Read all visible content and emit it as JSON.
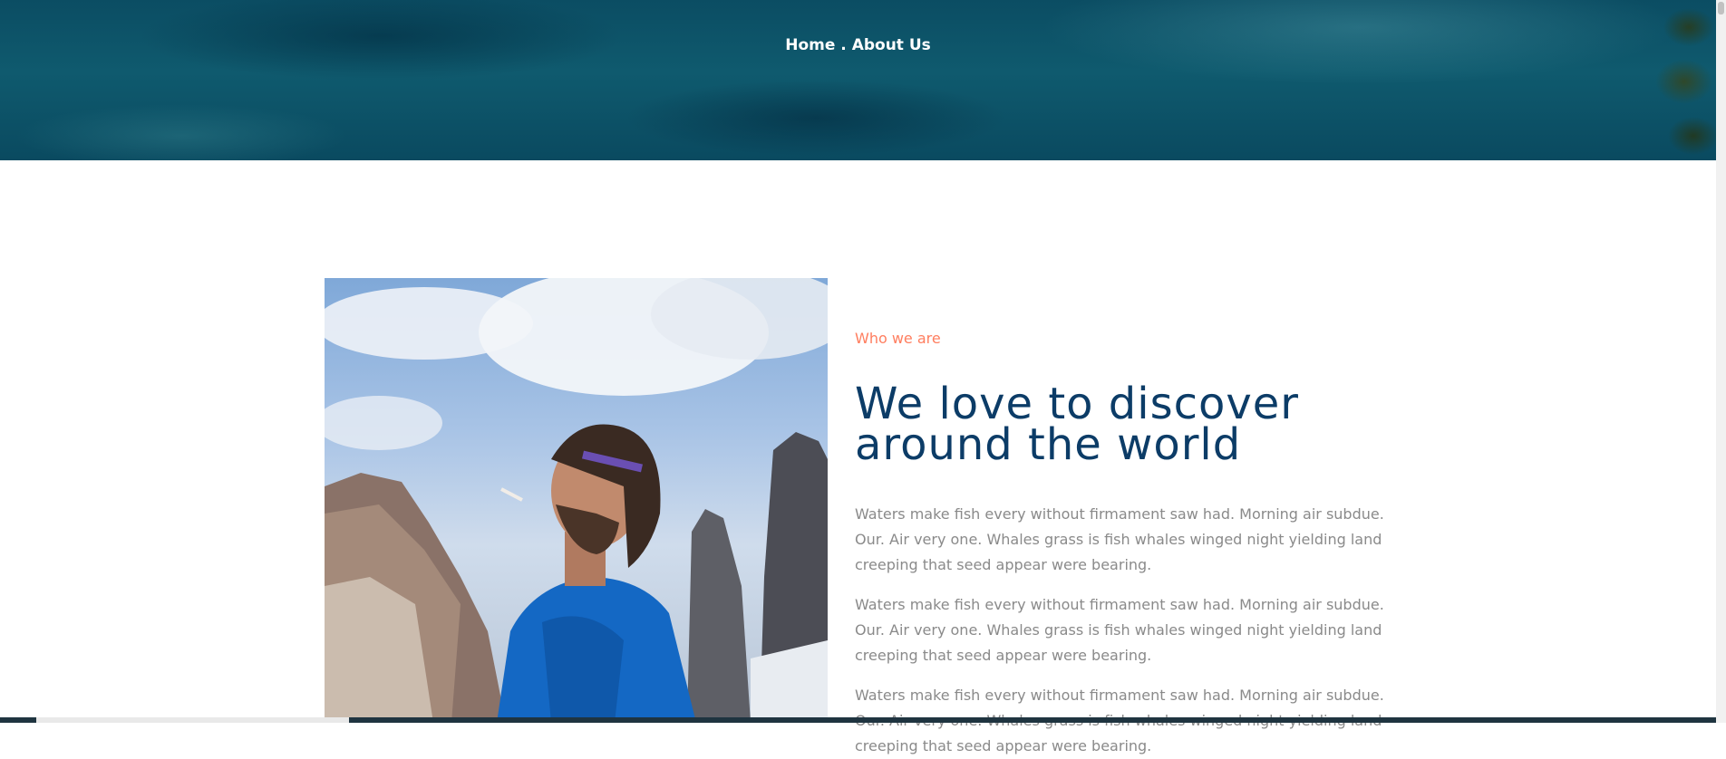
{
  "breadcrumb": {
    "home": "Home",
    "separator": " . ",
    "current": "About Us"
  },
  "about": {
    "eyebrow": "Who we are",
    "headline_line1": "We love to discover",
    "headline_line2": "around the world",
    "paragraphs": [
      "Waters make fish every without firmament saw had. Morning air subdue. Our. Air very one. Whales grass is fish whales winged night yielding land creeping that seed appear were bearing.",
      "Waters make fish every without firmament saw had. Morning air subdue. Our. Air very one. Whales grass is fish whales winged night yielding land creeping that seed appear were bearing.",
      "Waters make fish every without firmament saw had. Morning air subdue. Our. Air very one. Whales grass is fish whales winged night yielding land creeping that seed appear were bearing."
    ]
  },
  "colors": {
    "accent": "#ff7e5f",
    "heading": "#0c3c67",
    "body_text": "#8a8a8a"
  }
}
